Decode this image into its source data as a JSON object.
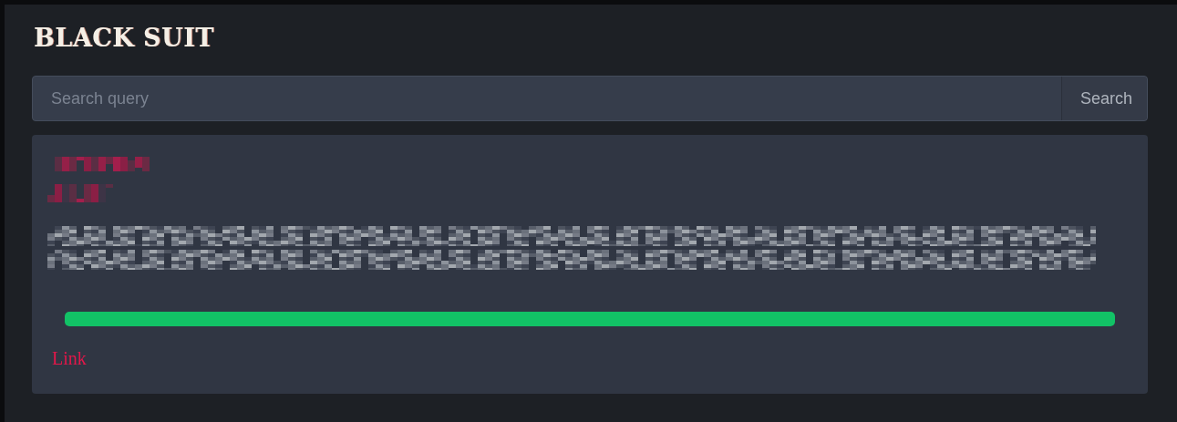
{
  "header": {
    "title": "BLACK SUIT"
  },
  "search": {
    "placeholder": "Search query",
    "button": "Search"
  },
  "result": {
    "redacted_lines": [
      {
        "kind": "title"
      },
      {
        "kind": "subtitle"
      },
      {
        "kind": "body"
      },
      {
        "kind": "body"
      }
    ],
    "link": "Link"
  }
}
